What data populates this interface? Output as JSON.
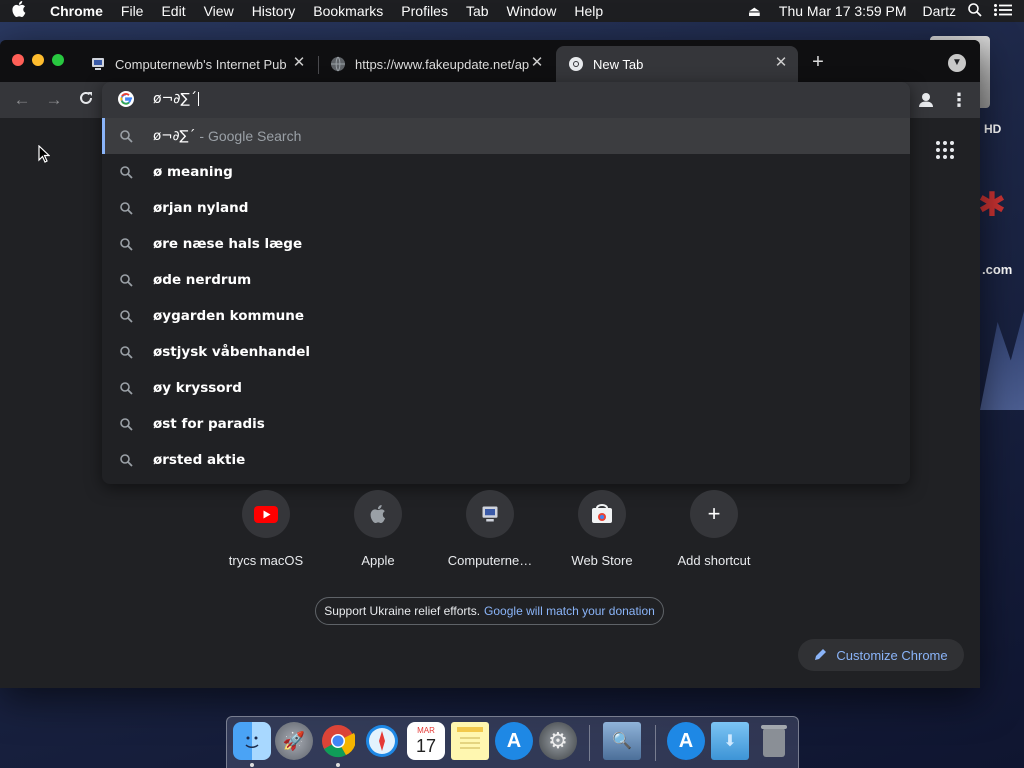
{
  "menubar": {
    "app_name": "Chrome",
    "items": [
      "File",
      "Edit",
      "View",
      "History",
      "Bookmarks",
      "Profiles",
      "Tab",
      "Window",
      "Help"
    ],
    "clock": "Thu Mar 17  3:59 PM",
    "user": "Dartz"
  },
  "desktop": {
    "hd_label": "HD",
    "com_label": ".com"
  },
  "tabs": [
    {
      "title": "Computernewb's Internet Pub",
      "active": false
    },
    {
      "title": "https://www.fakeupdate.net/ap",
      "active": false
    },
    {
      "title": "New Tab",
      "active": true
    }
  ],
  "omnibox": {
    "input_value": "ø¬∂∑´",
    "suggestions": [
      {
        "text": "ø¬∂∑´",
        "suffix": "- Google Search",
        "selected": true
      },
      {
        "text": "ø meaning"
      },
      {
        "text": "ørjan nyland"
      },
      {
        "text": "øre næse hals læge"
      },
      {
        "text": "øde nerdrum"
      },
      {
        "text": "øygarden kommune"
      },
      {
        "text": "østjysk våbenhandel"
      },
      {
        "text": "øy kryssord"
      },
      {
        "text": "øst for paradis"
      },
      {
        "text": "ørsted aktie"
      }
    ]
  },
  "shortcuts": [
    {
      "label": "trycs macOS",
      "icon": "youtube-icon"
    },
    {
      "label": "Apple",
      "icon": "apple-icon"
    },
    {
      "label": "Computerne…",
      "icon": "computer-icon"
    },
    {
      "label": "Web Store",
      "icon": "webstore-icon"
    },
    {
      "label": "Add shortcut",
      "icon": "plus-icon"
    }
  ],
  "promo": {
    "text": "Support Ukraine relief efforts.",
    "link": "Google will match your donation"
  },
  "customize_label": "Customize Chrome",
  "dock": {
    "calendar_month": "MAR",
    "calendar_day": "17"
  },
  "colors": {
    "accent_link": "#8ab4f8",
    "window_bg": "#202124",
    "toolbar_bg": "#35363a"
  }
}
